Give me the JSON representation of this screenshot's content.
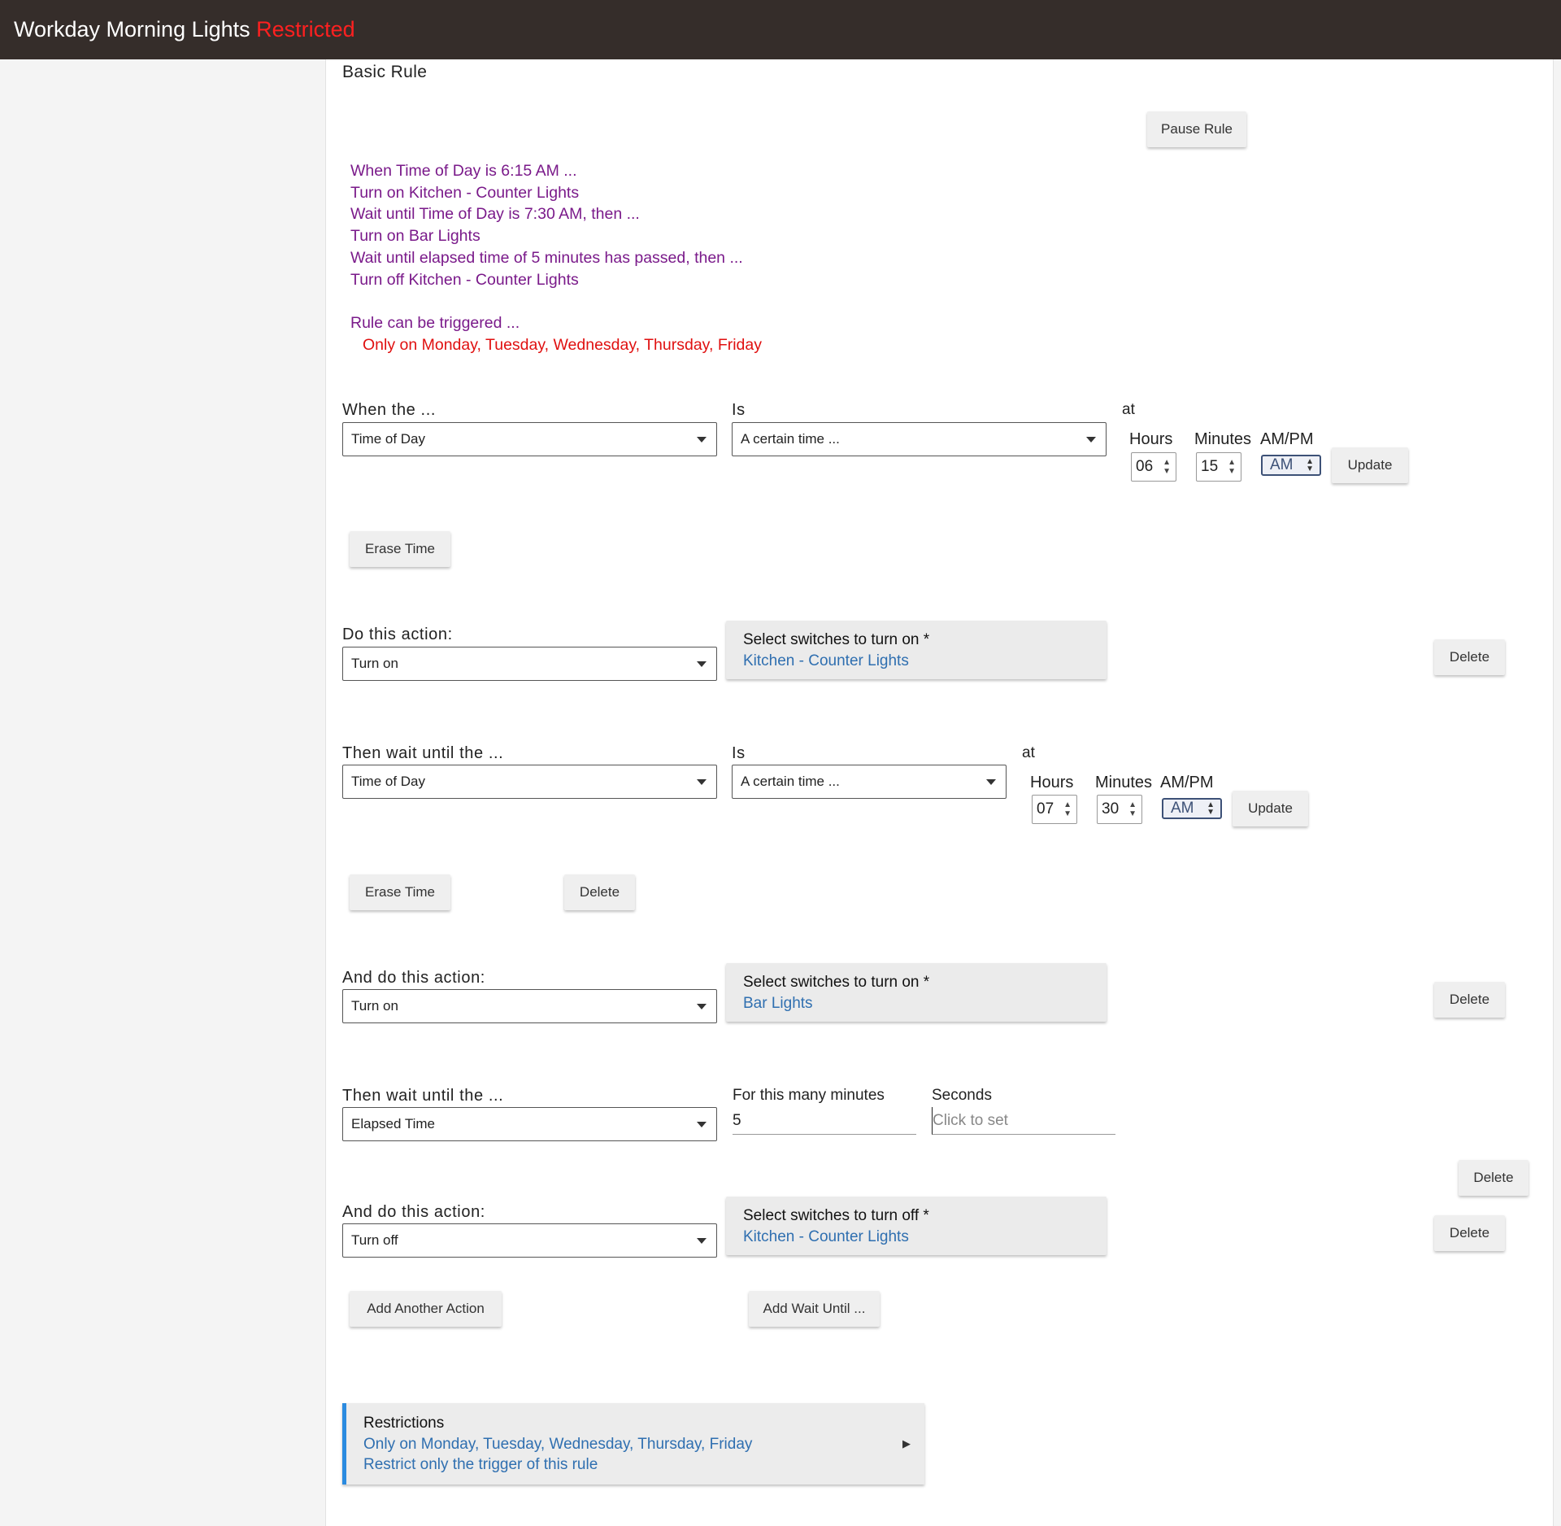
{
  "header": {
    "title": "Workday Morning Lights",
    "status": "Restricted"
  },
  "section_title": "Basic Rule",
  "pause_button": "Pause Rule",
  "description": {
    "lines": [
      "When Time of Day is 6:15 AM ...",
      "Turn on Kitchen - Counter Lights",
      "Wait until Time of Day is 7:30 AM, then ...",
      "Turn on Bar Lights",
      "Wait until elapsed time of 5 minutes has passed, then ...",
      "Turn off Kitchen - Counter Lights"
    ],
    "trigger_line": "Rule can be triggered ...",
    "restriction_line": "Only on Monday, Tuesday, Wednesday, Thursday, Friday"
  },
  "trigger": {
    "when_label": "When the ...",
    "when_value": "Time of Day",
    "is_label": "Is",
    "is_value": "A certain time ...",
    "at_label": "at",
    "hours_label": "Hours",
    "minutes_label": "Minutes",
    "ampm_label": "AM/PM",
    "hours": "06",
    "minutes": "15",
    "ampm": "AM",
    "update": "Update",
    "erase": "Erase Time"
  },
  "action1": {
    "label": "Do this action:",
    "value": "Turn on",
    "card_title": "Select switches to turn on *",
    "card_value": "Kitchen - Counter Lights",
    "delete": "Delete"
  },
  "wait1": {
    "label": "Then wait until the ...",
    "value": "Time of Day",
    "is_label": "Is",
    "is_value": "A certain time ...",
    "at_label": "at",
    "hours_label": "Hours",
    "minutes_label": "Minutes",
    "ampm_label": "AM/PM",
    "hours": "07",
    "minutes": "30",
    "ampm": "AM",
    "update": "Update",
    "erase": "Erase Time",
    "delete": "Delete"
  },
  "action2": {
    "label": "And do this action:",
    "value": "Turn on",
    "card_title": "Select switches to turn on *",
    "card_value": "Bar Lights",
    "delete": "Delete"
  },
  "wait2": {
    "label": "Then wait until the ...",
    "value": "Elapsed Time",
    "minutes_label": "For this many minutes",
    "minutes_value": "5",
    "seconds_label": "Seconds",
    "seconds_placeholder": "Click to set",
    "delete": "Delete"
  },
  "action3": {
    "label": "And do this action:",
    "value": "Turn off",
    "card_title": "Select switches to turn off *",
    "card_value": "Kitchen - Counter Lights",
    "delete": "Delete"
  },
  "footer_buttons": {
    "add_action": "Add Another Action",
    "add_wait": "Add Wait Until ..."
  },
  "restrictions": {
    "title": "Restrictions",
    "line1": "Only on Monday, Tuesday, Wednesday, Thursday, Friday",
    "line2": "Restrict only the trigger of this rule"
  },
  "colors": {
    "header_bg": "#352d2a",
    "restricted": "#ff2020",
    "description": "#7a1a8a",
    "link": "#2f6fb0",
    "accent": "#2b8be0"
  }
}
